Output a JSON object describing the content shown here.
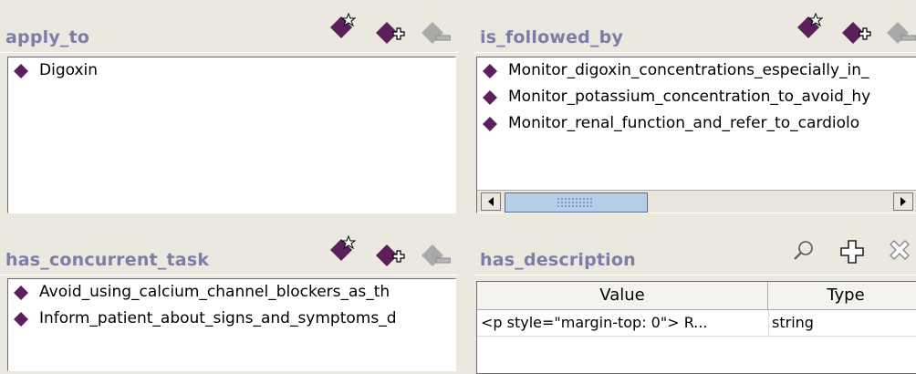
{
  "apply_to": {
    "title": "apply_to",
    "items": [
      "Digoxin"
    ]
  },
  "is_followed_by": {
    "title": "is_followed_by",
    "items": [
      "Monitor_digoxin_concentrations_especially_in_",
      "Monitor_potassium_concentration_to_avoid_hy",
      "Monitor_renal_function_and_refer_to_cardiolo"
    ]
  },
  "has_concurrent_task": {
    "title": "has_concurrent_task",
    "items": [
      "Avoid_using_calcium_channel_blockers_as_th",
      "Inform_patient_about_signs_and_symptoms_d"
    ]
  },
  "has_description": {
    "title": "has_description",
    "columns": [
      "Value",
      "Type"
    ],
    "rows": [
      {
        "value": "<p style=\"margin-top: 0\">      R...",
        "type": "string"
      }
    ]
  },
  "icons": {
    "create": "create-instance-icon",
    "add": "add-instance-icon",
    "remove": "remove-instance-icon",
    "view": "magnifier-icon",
    "add_value": "plus-icon",
    "delete_value": "delete-x-icon"
  },
  "colors": {
    "instance_diamond": "#5b1f5c",
    "title_text": "#7d7da6",
    "background": "#ebe8e0",
    "scroll_thumb": "#b7cde8"
  }
}
